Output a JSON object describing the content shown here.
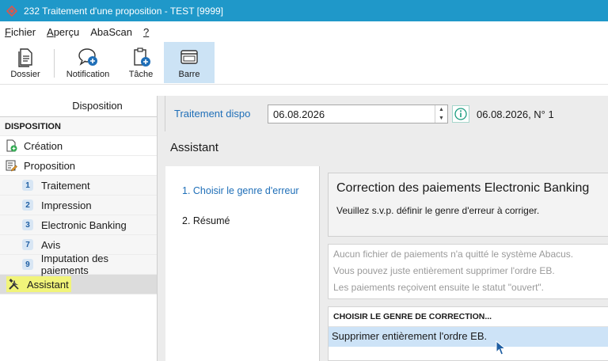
{
  "window": {
    "title": "232 Traitement d'une proposition - TEST [9999]"
  },
  "menu": {
    "items": [
      {
        "mnemonic": "F",
        "rest": "ichier"
      },
      {
        "mnemonic": "A",
        "rest": "perçu"
      },
      {
        "mnemonic": "",
        "rest": "AbaScan"
      },
      {
        "mnemonic": "?",
        "rest": ""
      }
    ]
  },
  "toolbar": {
    "dossier": "Dossier",
    "notification": "Notification",
    "tache": "Tâche",
    "barre": "Barre"
  },
  "sidebar": {
    "header": "Disposition",
    "section": "DISPOSITION",
    "creation": "Création",
    "proposition": "Proposition",
    "items": [
      {
        "num": "1",
        "label": "Traitement"
      },
      {
        "num": "2",
        "label": "Impression"
      },
      {
        "num": "3",
        "label": "Electronic Banking"
      },
      {
        "num": "7",
        "label": "Avis"
      },
      {
        "num": "9",
        "label": "Imputation des paiements"
      }
    ],
    "assistant": "Assistant"
  },
  "topbar": {
    "label": "Traitement dispo",
    "date_value": "06.08.2026",
    "info": "06.08.2026, N° 1"
  },
  "assistant": {
    "title": "Assistant",
    "steps": [
      "1. Choisir le genre d'erreur",
      "2. Résumé"
    ],
    "correction_title": "Correction des paiements Electronic Banking",
    "correction_sub": "Veuillez s.v.p. définir le genre d'erreur à corriger.",
    "notes": [
      "Aucun fichier de paiements n'a quitté le système Abacus.",
      "Vous pouvez juste entièrement supprimer l'ordre EB.",
      "Les paiements reçoivent ensuite le statut \"ouvert\"."
    ],
    "choice_header": "CHOISIR LE GENRE DE CORRECTION...",
    "choice_selected": "Supprimer entièrement l'ordre EB."
  },
  "colors": {
    "titlebar": "#1f98c9",
    "accent_blue": "#1f6fb8",
    "highlight_yellow": "#f1f47a",
    "selection": "#cde3f7"
  }
}
